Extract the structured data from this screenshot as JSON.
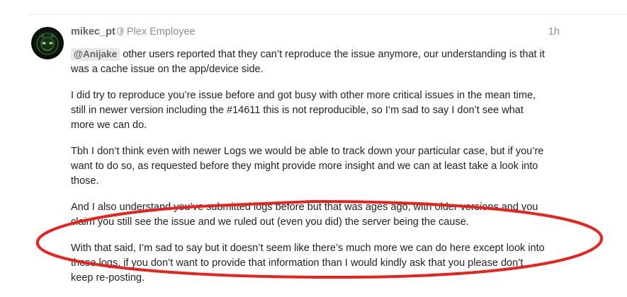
{
  "post": {
    "author": {
      "username": "mikec_pt",
      "title": "Plex Employee",
      "badge_icon": "shield-icon"
    },
    "date": "1h",
    "mention": "@Anijake",
    "paragraphs": [
      " other users reported that they can’t reproduce the issue anymore, our understanding is that it\nwas a cache issue on the app/device side.",
      "I did try to reproduce you’re issue before and got busy with other more critical issues in the mean time,\nstill in newer version including the #14611 this is not reproducible, so I’m sad to say I don’t see what\nmore we can do.",
      "Tbh I don’t think even with newer Logs we would be able to track down your particular case, but if you’re\nwant to do so, as requested before they might provide more insight and we can at least take a look into\nthose.",
      "And I also understand you’ve submitted logs before but that was ages ago, with older versions and you\nclaim you still see the issue and we ruled out (even you did) the server being the cause.",
      "With that said, I’m sad to say but it doesn’t seem like there’s much more we can do here except look into\nthose logs, if you don’t want to provide that information than I would kindly ask that you please don’t\nkeep re-posting."
    ]
  },
  "colors": {
    "annotation_ellipse": "#e8231b",
    "text": "#222222",
    "muted": "#8f8f8f",
    "username": "#646464",
    "mention_bg": "#e9e9e9"
  }
}
